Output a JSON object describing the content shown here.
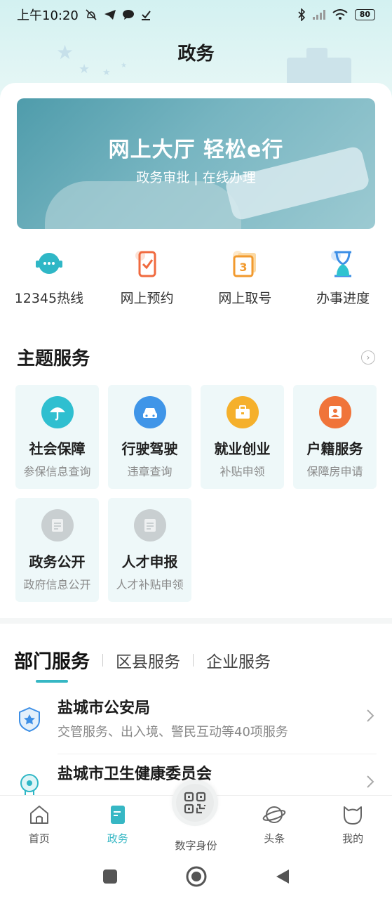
{
  "status_bar": {
    "time": "上午10:20",
    "battery": "80"
  },
  "header": {
    "title": "政务"
  },
  "banner": {
    "title": "网上大厅 轻松e行",
    "subtitle": "政务审批 | 在线办理"
  },
  "quick_actions": [
    {
      "label": "12345热线",
      "icon": "headset-icon",
      "color": "#2fb7c6"
    },
    {
      "label": "网上预约",
      "icon": "phone-check-icon",
      "color": "#f06a3f"
    },
    {
      "label": "网上取号",
      "icon": "ticket-number-icon",
      "color": "#f29a2e"
    },
    {
      "label": "办事进度",
      "icon": "hourglass-icon",
      "color": "#3d8fe6"
    }
  ],
  "theme_section": {
    "title": "主题服务"
  },
  "theme_services": [
    {
      "title": "社会保障",
      "subtitle": "参保信息查询",
      "icon": "umbrella-icon",
      "color": "#2fbfd0"
    },
    {
      "title": "行驶驾驶",
      "subtitle": "违章查询",
      "icon": "car-icon",
      "color": "#3f95e8"
    },
    {
      "title": "就业创业",
      "subtitle": "补贴申领",
      "icon": "briefcase-icon",
      "color": "#f5b02c"
    },
    {
      "title": "户籍服务",
      "subtitle": "保障房申请",
      "icon": "person-card-icon",
      "color": "#f0743a"
    },
    {
      "title": "政务公开",
      "subtitle": "政府信息公开",
      "icon": "document-icon",
      "color": "#c9cfd1"
    },
    {
      "title": "人才申报",
      "subtitle": "人才补贴申领",
      "icon": "document-icon",
      "color": "#c9cfd1"
    }
  ],
  "tabs": [
    {
      "label": "部门服务",
      "active": true
    },
    {
      "label": "区县服务",
      "active": false
    },
    {
      "label": "企业服务",
      "active": false
    }
  ],
  "departments": [
    {
      "name": "盐城市公安局",
      "desc": "交管服务、出入境、警民互动等40项服务",
      "icon": "police-badge-icon"
    },
    {
      "name": "盐城市卫生健康委员会",
      "desc": "",
      "icon": "health-icon"
    }
  ],
  "bottom_nav": [
    {
      "label": "首页",
      "icon": "home-icon",
      "active": false
    },
    {
      "label": "政务",
      "icon": "document-tab-icon",
      "active": true
    },
    {
      "label": "数字身份",
      "icon": "qr-code-icon",
      "active": false
    },
    {
      "label": "头条",
      "icon": "planet-icon",
      "active": false
    },
    {
      "label": "我的",
      "icon": "profile-icon",
      "active": false
    }
  ],
  "colors": {
    "accent": "#36b7c4",
    "header_bg": "#d3f1f1"
  }
}
